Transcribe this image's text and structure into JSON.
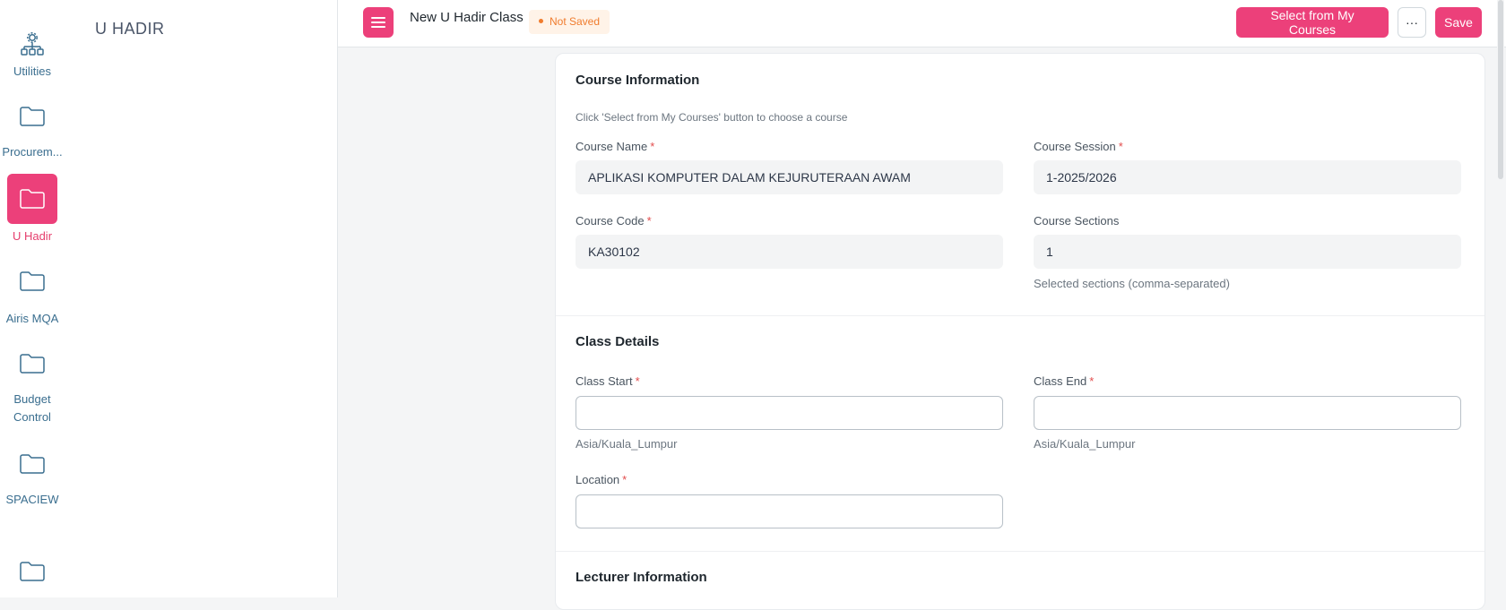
{
  "rail": {
    "items": [
      {
        "label": "Utilities",
        "icon": "org-chart-icon"
      },
      {
        "label": "Procurem...",
        "icon": "folder-icon"
      },
      {
        "label": "U Hadir",
        "icon": "folder-icon"
      },
      {
        "label": "Airis MQA",
        "icon": "folder-icon"
      },
      {
        "label": "Budget Control",
        "icon": "folder-icon"
      },
      {
        "label": "SPACIEW",
        "icon": "folder-icon"
      },
      {
        "label": "",
        "icon": "folder-icon"
      }
    ],
    "active_index": 2
  },
  "sidebar": {
    "title": "U HADIR"
  },
  "header": {
    "title": "New U Hadir Class",
    "status_badge": "Not Saved",
    "select_courses_label": "Select from My Courses",
    "more_label": "···",
    "save_label": "Save"
  },
  "course_info": {
    "title": "Course Information",
    "hint": "Click 'Select from My Courses' button to choose a course",
    "course_name_label": "Course Name",
    "course_name_value": "APLIKASI KOMPUTER DALAM KEJURUTERAAN AWAM",
    "course_session_label": "Course Session",
    "course_session_value": "1-2025/2026",
    "course_code_label": "Course Code",
    "course_code_value": "KA30102",
    "course_sections_label": "Course Sections",
    "course_sections_value": "1",
    "course_sections_desc": "Selected sections (comma-separated)"
  },
  "class_details": {
    "title": "Class Details",
    "class_start_label": "Class Start",
    "class_start_value": "",
    "class_start_tz": "Asia/Kuala_Lumpur",
    "class_end_label": "Class End",
    "class_end_value": "",
    "class_end_tz": "Asia/Kuala_Lumpur",
    "location_label": "Location",
    "location_value": ""
  },
  "lecturer_info": {
    "title": "Lecturer Information"
  },
  "required_marker": "*",
  "colors": {
    "accent": "#ec407a",
    "rail_text": "#3a6e8f",
    "badge_text": "#f07c2e"
  }
}
